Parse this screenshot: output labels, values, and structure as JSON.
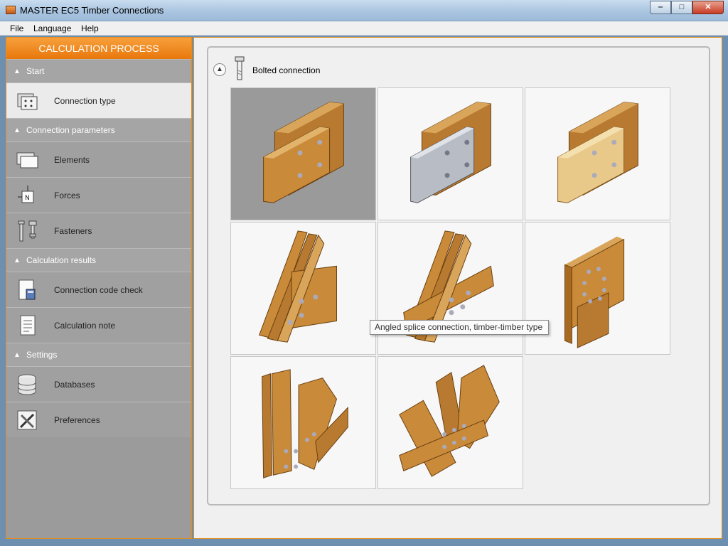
{
  "window": {
    "title": "MASTER EC5 Timber Connections",
    "minimize": "‒",
    "maximize": "□",
    "close": "✕"
  },
  "menu": [
    "File",
    "Language",
    "Help"
  ],
  "sidebar": {
    "header": "CALCULATION PROCESS",
    "sections": [
      {
        "title": "Start",
        "items": [
          {
            "label": "Connection type",
            "icon": "connection-type-icon"
          }
        ]
      },
      {
        "title": "Connection parameters",
        "items": [
          {
            "label": "Elements",
            "icon": "elements-icon"
          },
          {
            "label": "Forces",
            "icon": "forces-icon"
          },
          {
            "label": "Fasteners",
            "icon": "fasteners-icon"
          }
        ]
      },
      {
        "title": "Calculation results",
        "items": [
          {
            "label": "Connection code check",
            "icon": "code-check-icon"
          },
          {
            "label": "Calculation note",
            "icon": "calculation-note-icon"
          }
        ]
      },
      {
        "title": "Settings",
        "items": [
          {
            "label": "Databases",
            "icon": "databases-icon"
          },
          {
            "label": "Preferences",
            "icon": "preferences-icon"
          }
        ]
      }
    ]
  },
  "main": {
    "section_title": "Bolted connection",
    "tooltip": "Angled splice connection, timber-timber type"
  },
  "colors": {
    "accent": "#e8780c",
    "timber": "#c98a3a",
    "steel": "#b8bcc4",
    "selected": "#9a9a9a"
  }
}
